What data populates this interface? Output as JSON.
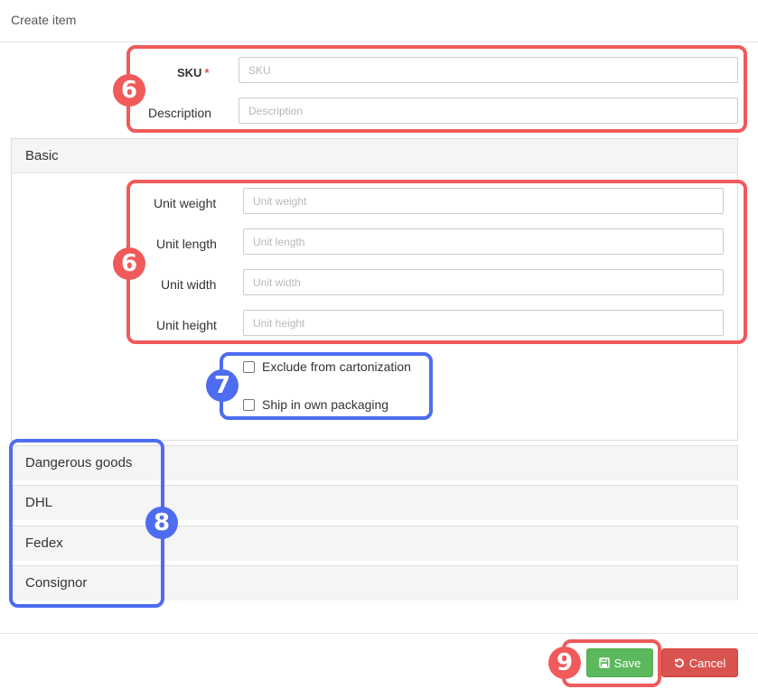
{
  "header": {
    "title": "Create item"
  },
  "top_fields": {
    "sku": {
      "label": "SKU",
      "required_mark": "*",
      "placeholder": "SKU",
      "value": ""
    },
    "description": {
      "label": "Description",
      "placeholder": "Description",
      "value": ""
    }
  },
  "basic_panel": {
    "title": "Basic",
    "fields": [
      {
        "label": "Unit weight",
        "placeholder": "Unit weight"
      },
      {
        "label": "Unit length",
        "placeholder": "Unit length"
      },
      {
        "label": "Unit width",
        "placeholder": "Unit width"
      },
      {
        "label": "Unit height",
        "placeholder": "Unit height"
      }
    ],
    "checkboxes": [
      {
        "label": "Exclude from cartonization",
        "checked": false
      },
      {
        "label": "Ship in own packaging",
        "checked": false
      }
    ]
  },
  "collapsed_panels": [
    {
      "title": "Dangerous goods"
    },
    {
      "title": "DHL"
    },
    {
      "title": "Fedex"
    },
    {
      "title": "Consignor"
    }
  ],
  "footer": {
    "save_label": "Save",
    "cancel_label": "Cancel"
  },
  "annotations": {
    "top_fields": "6",
    "basic_fields": "6",
    "checkboxes": "7",
    "panels": "8",
    "save": "9"
  },
  "colors": {
    "annotation_red": "#f05a5a",
    "annotation_blue": "#4d6cf0",
    "save_green": "#5cb85c",
    "cancel_red": "#d9534f"
  }
}
